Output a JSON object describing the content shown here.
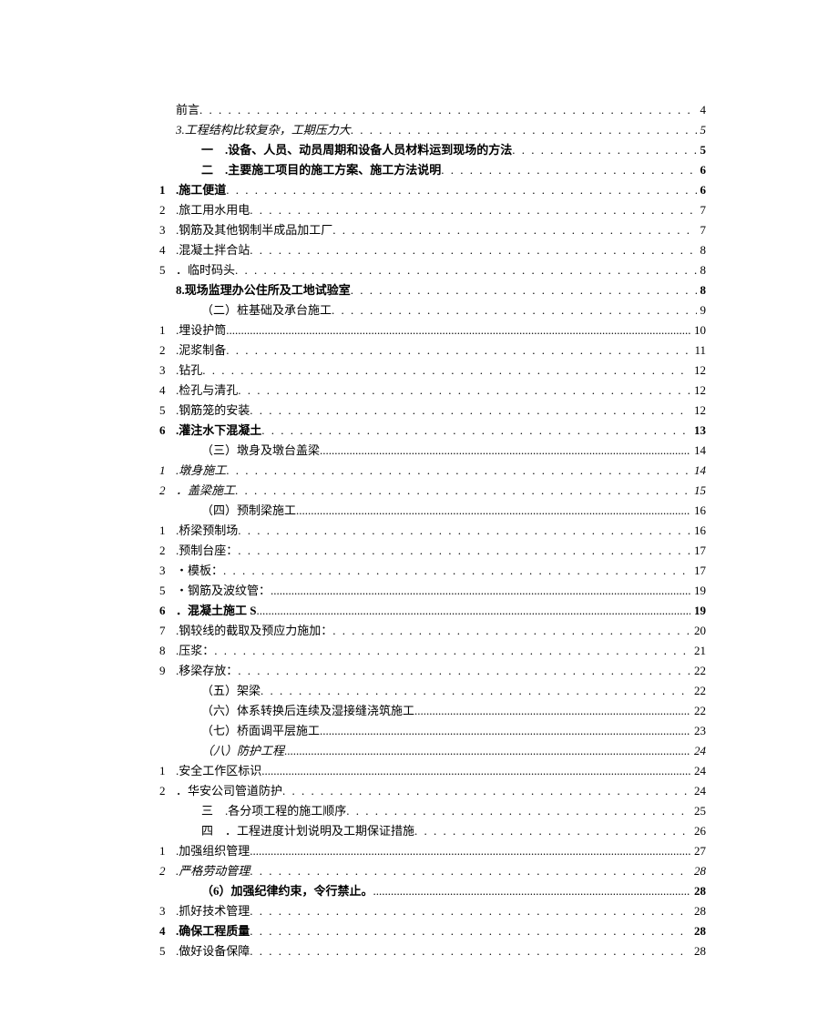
{
  "toc": [
    {
      "num": "",
      "text": "前言",
      "page": "4",
      "indent": 0,
      "bold": false,
      "italic": false,
      "tight": false
    },
    {
      "num": "",
      "text": "3.工程结构比较复杂，工期压力大",
      "page": "5",
      "indent": 0,
      "bold": false,
      "italic": true,
      "tight": false
    },
    {
      "num": "",
      "text": "一　.设备、人员、动员周期和设备人员材料运到现场的方法",
      "page": "5",
      "indent": 1,
      "bold": true,
      "italic": false,
      "tight": false
    },
    {
      "num": "",
      "text": "二　.主要施工项目的施工方案、施工方法说明",
      "page": "6",
      "indent": 1,
      "bold": true,
      "italic": false,
      "tight": false
    },
    {
      "num": "1",
      "text": ".施工便道",
      "page": "6",
      "indent": 0,
      "bold": true,
      "italic": false,
      "tight": false
    },
    {
      "num": "2",
      "text": ".旅工用水用电",
      "page": "7",
      "indent": 0,
      "bold": false,
      "italic": false,
      "tight": false
    },
    {
      "num": "3",
      "text": ".钢筋及其他钢制半成品加工厂",
      "page": "7",
      "indent": 0,
      "bold": false,
      "italic": false,
      "tight": false
    },
    {
      "num": "4",
      "text": ".混凝土拌合站",
      "page": "8",
      "indent": 0,
      "bold": false,
      "italic": false,
      "tight": false
    },
    {
      "num": "5",
      "text": "．临时码头",
      "page": "8",
      "indent": 0,
      "bold": false,
      "italic": false,
      "tight": false
    },
    {
      "num": "",
      "text": "8.现场监理办公住所及工地试验室",
      "page": "8",
      "indent": 0,
      "bold": true,
      "italic": false,
      "tight": false
    },
    {
      "num": "",
      "text": "（二）桩基础及承台施工",
      "page": "9",
      "indent": 1,
      "bold": false,
      "italic": false,
      "tight": false
    },
    {
      "num": "1",
      "text": ".埋设护筒",
      "page": "10",
      "indent": 0,
      "bold": false,
      "italic": false,
      "tight": true
    },
    {
      "num": "2",
      "text": ".泥浆制备",
      "page": "11",
      "indent": 0,
      "bold": false,
      "italic": false,
      "tight": false
    },
    {
      "num": "3",
      "text": ".钻孔",
      "page": "12",
      "indent": 0,
      "bold": false,
      "italic": false,
      "tight": false
    },
    {
      "num": "4",
      "text": ".检孔与清孔",
      "page": "12",
      "indent": 0,
      "bold": false,
      "italic": false,
      "tight": false
    },
    {
      "num": "5",
      "text": ".钢筋笼的安装",
      "page": "12",
      "indent": 0,
      "bold": false,
      "italic": false,
      "tight": false
    },
    {
      "num": "6",
      "text": ".灌注水下混凝土",
      "page": "13",
      "indent": 0,
      "bold": true,
      "italic": false,
      "tight": false
    },
    {
      "num": "",
      "text": "（三）墩身及墩台盖梁",
      "page": "14",
      "indent": 1,
      "bold": false,
      "italic": false,
      "tight": true
    },
    {
      "num": "1",
      "text": ".墩身施工",
      "page": "14",
      "indent": 0,
      "bold": false,
      "italic": true,
      "tight": false
    },
    {
      "num": "2",
      "text": "．盖梁施工",
      "page": "15",
      "indent": 0,
      "bold": false,
      "italic": true,
      "tight": false
    },
    {
      "num": "",
      "text": "（四）预制梁施工",
      "page": "16",
      "indent": 1,
      "bold": false,
      "italic": false,
      "tight": true
    },
    {
      "num": "1",
      "text": ".桥梁预制场",
      "page": "16",
      "indent": 0,
      "bold": false,
      "italic": false,
      "tight": false
    },
    {
      "num": "2",
      "text": ".预制台座：",
      "page": "17",
      "indent": 0,
      "bold": false,
      "italic": false,
      "tight": false
    },
    {
      "num": "3",
      "text": "・模板：",
      "page": "17",
      "indent": 0,
      "bold": false,
      "italic": false,
      "tight": false
    },
    {
      "num": "5",
      "text": "・钢筋及波纹管：",
      "page": "19",
      "indent": 0,
      "bold": false,
      "italic": false,
      "tight": true
    },
    {
      "num": "6",
      "text": "．混凝土施工 S",
      "page": "19",
      "indent": 0,
      "bold": true,
      "italic": false,
      "tight": true
    },
    {
      "num": "7",
      "text": ".钢较线的截取及预应力施加：",
      "page": "20",
      "indent": 0,
      "bold": false,
      "italic": false,
      "tight": false
    },
    {
      "num": "8",
      "text": ".压浆：",
      "page": "21",
      "indent": 0,
      "bold": false,
      "italic": false,
      "tight": false
    },
    {
      "num": "9",
      "text": ".移梁存放：",
      "page": "22",
      "indent": 0,
      "bold": false,
      "italic": false,
      "tight": false
    },
    {
      "num": "",
      "text": "（五）架梁",
      "page": "22",
      "indent": 1,
      "bold": false,
      "italic": false,
      "tight": false
    },
    {
      "num": "",
      "text": "（六）体系转换后连续及湿接缝浇筑施工",
      "page": "22",
      "indent": 1,
      "bold": false,
      "italic": false,
      "tight": true
    },
    {
      "num": "",
      "text": "（七）桥面调平层施工",
      "page": "23",
      "indent": 1,
      "bold": false,
      "italic": false,
      "tight": true
    },
    {
      "num": "",
      "text": "（八）防护工程",
      "page": "24",
      "indent": 1,
      "bold": false,
      "italic": true,
      "tight": true
    },
    {
      "num": "1",
      "text": ".安全工作区标识",
      "page": "24",
      "indent": 0,
      "bold": false,
      "italic": false,
      "tight": true
    },
    {
      "num": "2",
      "text": "．华安公司管道防护",
      "page": "24",
      "indent": 0,
      "bold": false,
      "italic": false,
      "tight": false
    },
    {
      "num": "",
      "text": "三　.各分项工程的施工顺序",
      "page": "25",
      "indent": 1,
      "bold": false,
      "italic": false,
      "tight": false
    },
    {
      "num": "",
      "text": "四　．工程进度计划说明及工期保证措施",
      "page": "26",
      "indent": 1,
      "bold": false,
      "italic": false,
      "tight": false
    },
    {
      "num": "1",
      "text": ".加强组织管理",
      "page": "27",
      "indent": 0,
      "bold": false,
      "italic": false,
      "tight": true
    },
    {
      "num": "2",
      "text": ".严格劳动管理",
      "page": "28",
      "indent": 0,
      "bold": false,
      "italic": true,
      "tight": false
    },
    {
      "num": "",
      "text": "（6）加强纪律约束，令行禁止。",
      "page": "28",
      "indent": 1,
      "bold": true,
      "italic": false,
      "tight": true
    },
    {
      "num": "3",
      "text": ".抓好技术管理",
      "page": "28",
      "indent": 0,
      "bold": false,
      "italic": false,
      "tight": false
    },
    {
      "num": "4",
      "text": ".确保工程质量",
      "page": "28",
      "indent": 0,
      "bold": true,
      "italic": false,
      "tight": false
    },
    {
      "num": "5",
      "text": ".做好设备保障",
      "page": "28",
      "indent": 0,
      "bold": false,
      "italic": false,
      "tight": false
    }
  ]
}
